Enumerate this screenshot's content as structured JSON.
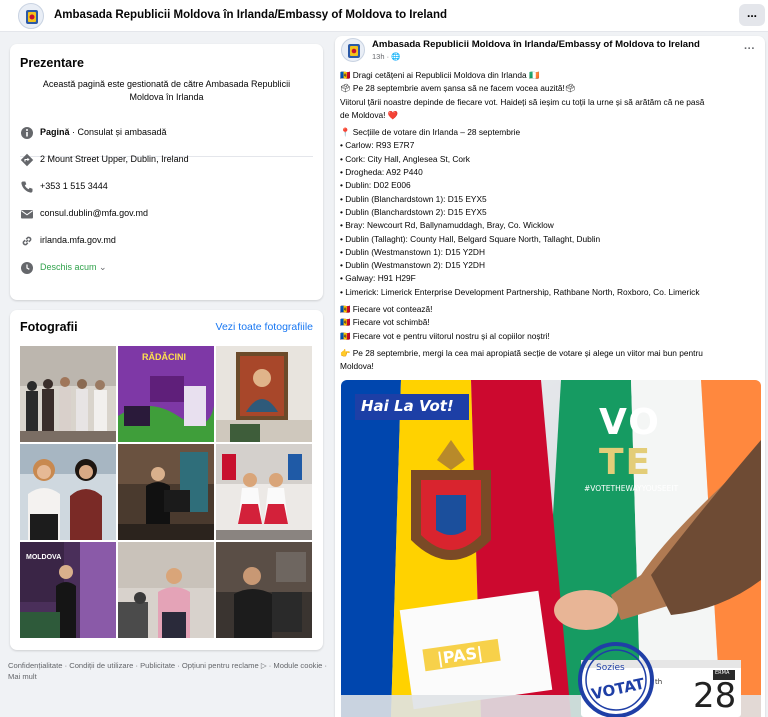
{
  "header": {
    "title": "Ambasada Republicii Moldova în Irlanda/Embassy of Moldova to Ireland",
    "more_label": "..."
  },
  "intro": {
    "title": "Prezentare",
    "description": "Această pagină este gestionată de către Ambasada Republicii Moldova în Irlanda",
    "category_prefix": "Pagină",
    "category": " · Consulat și ambasadă",
    "address": "2 Mount Street Upper, Dublin, Ireland",
    "phone": "+353 1 515 3444",
    "email": "consul.dublin@mfa.gov.md",
    "website": "irlanda.mfa.gov.md",
    "hours": "Deschis acum",
    "hours_chevron": "⌄"
  },
  "photos": {
    "title": "Fotografii",
    "see_all": "Vezi toate fotografiile",
    "photo2_caption": "RĂDĂCINI",
    "photo7_caption": "MOLDOVA"
  },
  "footer": {
    "text": "Confidențialitate · Condiții de utilizare · Publicitate · Opțiuni pentru reclame ▷ · Module cookie · Mai mult"
  },
  "post": {
    "author": "Ambasada Republicii Moldova în Irlanda/Embassy of Moldova to Ireland",
    "time": "13h · 🌐",
    "more": "···",
    "lines": [
      "🇲🇩 Dragi cetățeni ai Republicii Moldova din Irlanda 🇮🇪",
      "🗳 Pe 28 septembrie avem șansa să ne facem vocea auzită!🗳",
      "Viitorul țării noastre depinde de fiecare vot. Haideți să ieșim cu toții la urne și să arătăm că ne pasă",
      "de Moldova! ❤️",
      "",
      "📍 Secțiile de votare din Irlanda – 28 septembrie",
      "• Carlow: R93 E7R7",
      "• Cork: City Hall, Anglesea St, Cork",
      "• Drogheda: A92 P440",
      "• Dublin: D02 E006",
      "• Dublin (Blanchardstown 1): D15 EYX5",
      "• Dublin (Blanchardstown 2): D15 EYX5",
      "• Bray: Newcourt Rd, Ballynamuddagh, Bray, Co. Wicklow",
      "• Dublin (Tallaght): County Hall, Belgard Square North, Tallaght, Dublin",
      "• Dublin (Westmanstown 1): D15 Y2DH",
      "• Dublin (Westmanstown 2): D15 Y2DH",
      "• Galway: H91 H29F",
      "• Limerick: Limerick Enterprise Development Partnership, Rathbane North, Roxboro, Co. Limerick",
      "",
      "🇲🇩 Fiecare vot contează!",
      "🇲🇩 Fiecare vot schimbă!",
      "🇲🇩 Fiecare vot e pentru viitorul nostru și al copiilor noștri!",
      "",
      "👉 Pe 28 septembrie, mergi la cea mai apropiată secție de votare și alege un viitor mai bun pentru",
      "Moldova!"
    ],
    "image": {
      "badge": "Hai La Vot!",
      "vote_logo_line1": "VO",
      "vote_logo_line2": "TE",
      "hashtag": "#VOTETHEWAYYOUSEEIT",
      "ballot_text": "|PAS|",
      "stamp_top": "Sozies",
      "stamp_main": "VOTAT",
      "calendar_month": "ERMA",
      "calendar_day": "28",
      "calendar_suffix": "th"
    }
  }
}
